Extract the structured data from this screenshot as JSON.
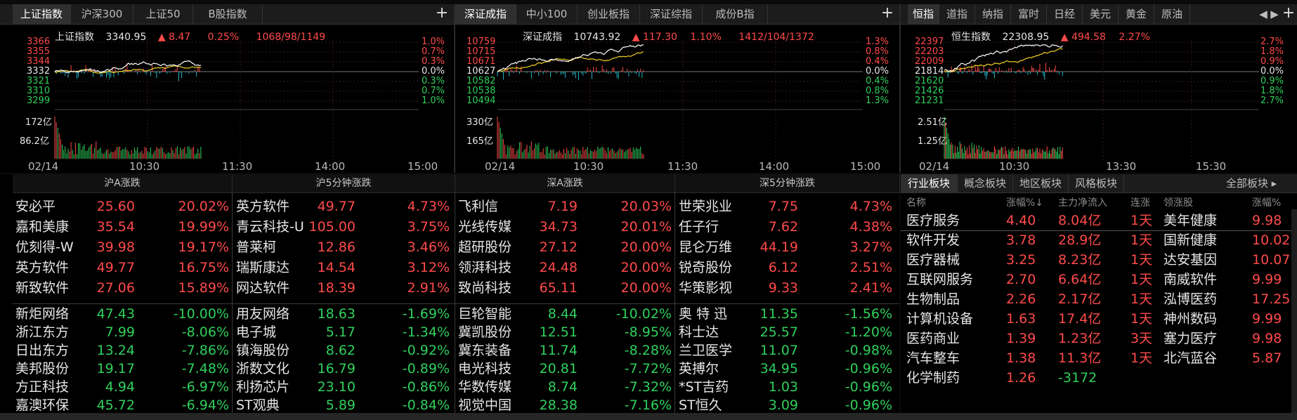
{
  "colors": {
    "up": "#ff4a4a",
    "down": "#2fd05c",
    "bg": "#000000",
    "white_line": "#ffffff",
    "yellow_line": "#f0d020"
  },
  "sh": {
    "tabs": [
      "上证指数",
      "沪深300",
      "上证50",
      "B股指数"
    ],
    "name": "上证指数",
    "price": "3340.95",
    "arrow": "▲",
    "change": "8.47",
    "pct": "0.25%",
    "breadth": "1068/98/1149",
    "y_left": [
      "3366",
      "3355",
      "3344",
      "3332",
      "3321",
      "3310",
      "3299"
    ],
    "y_right": [
      "1.0%",
      "0.7%",
      "0.3%",
      "0.0%",
      "0.3%",
      "0.7%",
      "1.0%"
    ],
    "vol_top": "172亿",
    "vol_mid": "86.2亿",
    "date": "02/14",
    "times": [
      "10:30",
      "11:30",
      "14:00",
      "15:00"
    ]
  },
  "sz": {
    "tabs": [
      "深证成指",
      "中小100",
      "创业板指",
      "深证综指",
      "成份B指"
    ],
    "name": "深证成指",
    "price": "10743.92",
    "arrow": "▲",
    "change": "117.30",
    "pct": "1.10%",
    "breadth": "1412/104/1372",
    "y_left": [
      "10759",
      "10715",
      "10671",
      "10627",
      "10582",
      "10538",
      "10494"
    ],
    "y_right": [
      "1.3%",
      "0.8%",
      "0.4%",
      "0.0%",
      "0.4%",
      "0.8%",
      "1.3%"
    ],
    "vol_top": "330亿",
    "vol_mid": "165亿",
    "date": "02/14",
    "times": [
      "10:30",
      "11:30",
      "14:00",
      "15:00"
    ]
  },
  "hk": {
    "tabs": [
      "恒指",
      "道指",
      "纳指",
      "富时",
      "日经",
      "美元",
      "黄金",
      "原油"
    ],
    "name": "恒生指数",
    "price": "22308.95",
    "arrow": "▲",
    "change": "494.58",
    "pct": "2.27%",
    "y_left": [
      "22397",
      "22203",
      "22009",
      "21814",
      "21620",
      "21426",
      "21231"
    ],
    "y_right": [
      "2.7%",
      "1.8%",
      "0.9%",
      "0.0%",
      "0.9%",
      "1.8%",
      "2.7%"
    ],
    "vol_top": "2.51亿",
    "vol_mid": "1.25亿",
    "date": "02/14",
    "times": [
      "10:30",
      "13:30",
      "15:30"
    ]
  },
  "tables": {
    "headers": [
      "沪A涨跌",
      "沪5分钟涨跌",
      "深A涨跌",
      "深5分钟涨跌"
    ],
    "sh_a_up": [
      [
        "安必平",
        "25.60",
        "20.02%"
      ],
      [
        "嘉和美康",
        "35.54",
        "19.99%"
      ],
      [
        "优刻得-W",
        "39.98",
        "19.17%"
      ],
      [
        "英方软件",
        "49.77",
        "16.75%"
      ],
      [
        "新致软件",
        "27.06",
        "15.89%"
      ]
    ],
    "sh_a_down": [
      [
        "新炬网络",
        "47.43",
        "-10.00%"
      ],
      [
        "浙江东方",
        "7.99",
        "-8.06%"
      ],
      [
        "日出东方",
        "13.24",
        "-7.86%"
      ],
      [
        "美邦股份",
        "19.17",
        "-7.48%"
      ],
      [
        "方正科技",
        "4.94",
        "-6.97%"
      ],
      [
        "嘉澳环保",
        "45.72",
        "-6.94%"
      ]
    ],
    "sh_5_up": [
      [
        "英方软件",
        "49.77",
        "4.73%"
      ],
      [
        "青云科技-U",
        "105.00",
        "3.75%"
      ],
      [
        "普莱柯",
        "12.86",
        "3.46%"
      ],
      [
        "瑞斯康达",
        "14.54",
        "3.12%"
      ],
      [
        "网达软件",
        "18.39",
        "2.91%"
      ]
    ],
    "sh_5_down": [
      [
        "用友网络",
        "18.63",
        "-1.69%"
      ],
      [
        "电子城",
        "5.17",
        "-1.34%"
      ],
      [
        "镇海股份",
        "8.62",
        "-0.92%"
      ],
      [
        "浙数文化",
        "16.79",
        "-0.89%"
      ],
      [
        "利扬芯片",
        "23.10",
        "-0.86%"
      ],
      [
        "ST观典",
        "5.89",
        "-0.84%"
      ]
    ],
    "sz_a_up": [
      [
        "飞利信",
        "7.19",
        "20.03%"
      ],
      [
        "光线传媒",
        "34.73",
        "20.01%"
      ],
      [
        "超研股份",
        "27.12",
        "20.00%"
      ],
      [
        "领湃科技",
        "24.48",
        "20.00%"
      ],
      [
        "致尚科技",
        "65.11",
        "20.00%"
      ]
    ],
    "sz_a_down": [
      [
        "巨轮智能",
        "8.44",
        "-10.02%"
      ],
      [
        "冀凯股份",
        "12.51",
        "-8.95%"
      ],
      [
        "冀东装备",
        "11.74",
        "-8.28%"
      ],
      [
        "电光科技",
        "20.81",
        "-7.72%"
      ],
      [
        "华数传媒",
        "8.74",
        "-7.32%"
      ],
      [
        "视觉中国",
        "28.38",
        "-7.16%"
      ]
    ],
    "sz_5_up": [
      [
        "世荣兆业",
        "7.75",
        "4.73%"
      ],
      [
        "任子行",
        "7.62",
        "4.38%"
      ],
      [
        "昆仑万维",
        "44.19",
        "3.27%"
      ],
      [
        "锐奇股份",
        "6.12",
        "2.51%"
      ],
      [
        "华策影视",
        "9.33",
        "2.41%"
      ]
    ],
    "sz_5_down": [
      [
        "奥 特 迅",
        "11.35",
        "-1.56%"
      ],
      [
        "科士达",
        "25.57",
        "-1.20%"
      ],
      [
        "兰卫医学",
        "11.07",
        "-0.98%"
      ],
      [
        "英搏尔",
        "34.95",
        "-0.96%"
      ],
      [
        "*ST吉药",
        "1.03",
        "-0.96%"
      ],
      [
        "ST恒久",
        "3.09",
        "-0.96%"
      ]
    ]
  },
  "sectors": {
    "tabs": [
      "行业板块",
      "概念板块",
      "地区板块",
      "风格板块",
      "全部板块"
    ],
    "columns": [
      "名称",
      "涨幅%↓",
      "主力净流入",
      "连涨",
      "领涨股",
      "涨幅%"
    ],
    "rows": [
      [
        "医疗服务",
        "4.40",
        "8.04亿",
        "1天",
        "美年健康",
        "9.98"
      ],
      [
        "软件开发",
        "3.78",
        "28.9亿",
        "1天",
        "国新健康",
        "10.02"
      ],
      [
        "医疗器械",
        "3.25",
        "8.23亿",
        "1天",
        "达安基因",
        "10.07"
      ],
      [
        "互联网服务",
        "2.70",
        "6.64亿",
        "1天",
        "南威软件",
        "9.99"
      ],
      [
        "生物制品",
        "2.26",
        "2.17亿",
        "1天",
        "泓博医药",
        "17.25"
      ],
      [
        "计算机设备",
        "1.63",
        "17.4亿",
        "1天",
        "神州数码",
        "9.99"
      ],
      [
        "医药商业",
        "1.39",
        "1.23亿",
        "3天",
        "塞力医疗",
        "9.98"
      ],
      [
        "汽车整车",
        "1.38",
        "11.3亿",
        "1天",
        "北汽蓝谷",
        "5.87"
      ],
      [
        "化学制药",
        "1.26",
        "-3172",
        "",
        "",
        " "
      ]
    ]
  }
}
